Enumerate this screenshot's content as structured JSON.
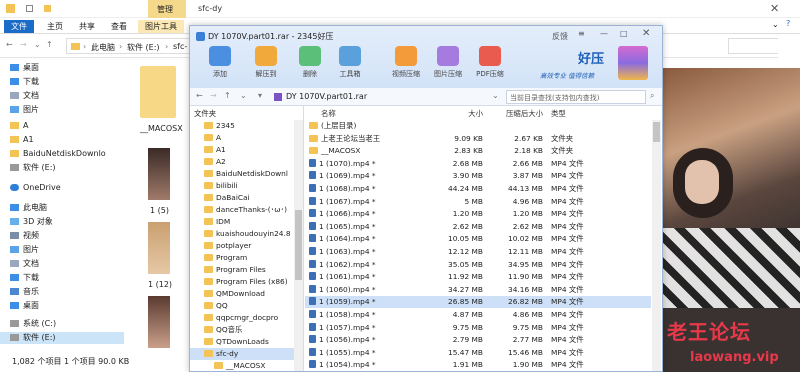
{
  "explorer": {
    "title": "sfc-dy",
    "ribbon_tabs": [
      "文件",
      "主页",
      "共享",
      "查看",
      "图片工具"
    ],
    "manage_label": "管理",
    "address": [
      "此电脑",
      "软件 (E:)",
      "sfc-"
    ],
    "nav_items": [
      "桌面",
      "下载",
      "文档",
      "图片",
      "A",
      "A1",
      "BaiduNetdiskDownlo",
      "软件 (E:)",
      "OneDrive",
      "此电脑",
      "3D 对象",
      "视频",
      "图片",
      "文档",
      "下载",
      "音乐",
      "桌面",
      "系统 (C:)",
      "软件 (E:)"
    ],
    "thumbs": [
      "__MACOSX",
      "1 (5)",
      "1 (12)"
    ],
    "status": "1,082 个项目   1 个项目 90.0 KB"
  },
  "zip": {
    "title": "DY 1070V.part01.rar - 2345好压",
    "feedback": "反馈",
    "toolbar": [
      "添加",
      "解压到",
      "删除",
      "工具箱",
      "视频压缩",
      "图片压缩",
      "PDF压缩"
    ],
    "brand": "好压",
    "slogan": "高效专业 值得信赖",
    "path": "DY 1070V.part01.rar",
    "search_placeholder": "当前目录查找(支持包内查找)",
    "tree_header": "文件夹",
    "tree": [
      "2345",
      "A",
      "A1",
      "A2",
      "BaiduNetdiskDownl",
      "bilibili",
      "DaBaiCai",
      "danceThanks-(･ω･)",
      "IDM",
      "kuaishoudouyin24.8",
      "potplayer",
      "Program",
      "Program Files",
      "Program Files (x86)",
      "QMDownload",
      "QQ",
      "qqpcmgr_docpro",
      "QQ音乐",
      "QTDownLoads",
      "sfc-dy",
      "__MACOSX",
      "选择位置"
    ],
    "columns": [
      "名称",
      "大小",
      "压缩后大小",
      "类型"
    ],
    "rows": [
      {
        "name": "(上层目录)",
        "size": "",
        "comp": "",
        "type": ""
      },
      {
        "name": "上老王论坛当老王",
        "size": "9.09 KB",
        "comp": "2.67 KB",
        "type": "文件夹"
      },
      {
        "name": "__MACOSX",
        "size": "2.83 KB",
        "comp": "2.18 KB",
        "type": "文件夹"
      },
      {
        "name": "1 (1070).mp4 *",
        "size": "2.68 MB",
        "comp": "2.66 MB",
        "type": "MP4 文件"
      },
      {
        "name": "1 (1069).mp4 *",
        "size": "3.90 MB",
        "comp": "3.87 MB",
        "type": "MP4 文件"
      },
      {
        "name": "1 (1068).mp4 *",
        "size": "44.24 MB",
        "comp": "44.13 MB",
        "type": "MP4 文件"
      },
      {
        "name": "1 (1067).mp4 *",
        "size": "5 MB",
        "comp": "4.96 MB",
        "type": "MP4 文件"
      },
      {
        "name": "1 (1066).mp4 *",
        "size": "1.20 MB",
        "comp": "1.20 MB",
        "type": "MP4 文件"
      },
      {
        "name": "1 (1065).mp4 *",
        "size": "2.62 MB",
        "comp": "2.62 MB",
        "type": "MP4 文件"
      },
      {
        "name": "1 (1064).mp4 *",
        "size": "10.05 MB",
        "comp": "10.02 MB",
        "type": "MP4 文件"
      },
      {
        "name": "1 (1063).mp4 *",
        "size": "12.12 MB",
        "comp": "12.11 MB",
        "type": "MP4 文件"
      },
      {
        "name": "1 (1062).mp4 *",
        "size": "35.05 MB",
        "comp": "34.95 MB",
        "type": "MP4 文件"
      },
      {
        "name": "1 (1061).mp4 *",
        "size": "11.92 MB",
        "comp": "11.90 MB",
        "type": "MP4 文件"
      },
      {
        "name": "1 (1060).mp4 *",
        "size": "34.27 MB",
        "comp": "34.16 MB",
        "type": "MP4 文件"
      },
      {
        "name": "1 (1059).mp4 *",
        "size": "26.85 MB",
        "comp": "26.82 MB",
        "type": "MP4 文件"
      },
      {
        "name": "1 (1058).mp4 *",
        "size": "4.87 MB",
        "comp": "4.86 MB",
        "type": "MP4 文件"
      },
      {
        "name": "1 (1057).mp4 *",
        "size": "9.75 MB",
        "comp": "9.75 MB",
        "type": "MP4 文件"
      },
      {
        "name": "1 (1056).mp4 *",
        "size": "2.79 MB",
        "comp": "2.77 MB",
        "type": "MP4 文件"
      },
      {
        "name": "1 (1055).mp4 *",
        "size": "15.47 MB",
        "comp": "15.46 MB",
        "type": "MP4 文件"
      },
      {
        "name": "1 (1054).mp4 *",
        "size": "1.91 MB",
        "comp": "1.90 MB",
        "type": "MP4 文件"
      }
    ]
  },
  "watermark": {
    "cn": "老王论坛",
    "en": "laowang.vip"
  }
}
